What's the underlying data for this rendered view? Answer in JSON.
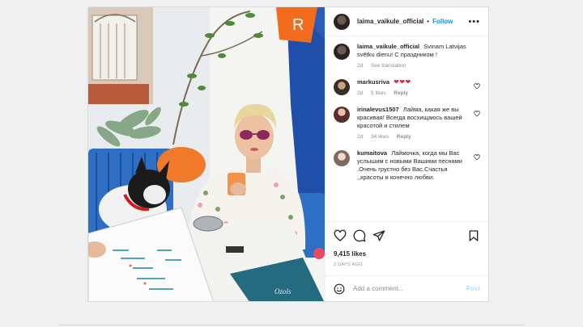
{
  "post": {
    "username": "laima_vaikule_official",
    "separator": "•",
    "follow_label": "Follow",
    "more_icon": "more-dots-icon",
    "caption": {
      "username": "laima_vaikule_official",
      "text": "Svinam Latvijas svētku dienu! С праздником !",
      "time": "2d",
      "see_translation": "See translation"
    },
    "comments": [
      {
        "username": "markusriva",
        "text": "❤❤❤",
        "time": "2d",
        "likes": "5 likes",
        "reply": "Reply"
      },
      {
        "username": "irinalevus1507",
        "text": "Лайма, какая же вы красивая! Всегда восхищаюсь вашей красотой и стилем",
        "time": "2d",
        "likes": "34 likes",
        "reply": "Reply"
      },
      {
        "username": "kumaitova",
        "text": "Лаймочка, когда мы Вас услышим с новыми Вашими песнями .Очень грустно без Вас.Счастья ,,красоты и конечно любви.",
        "time": "",
        "likes": "",
        "reply": ""
      }
    ],
    "like_count": "9,415 likes",
    "date": "2 DAYS AGO",
    "comment_placeholder": "Add a comment...",
    "post_label": "Post",
    "photo_sign_letter": "R"
  },
  "colors": {
    "accent": "#0095f6",
    "like_red": "#ed1f3a",
    "muted": "#8e8e8e"
  }
}
